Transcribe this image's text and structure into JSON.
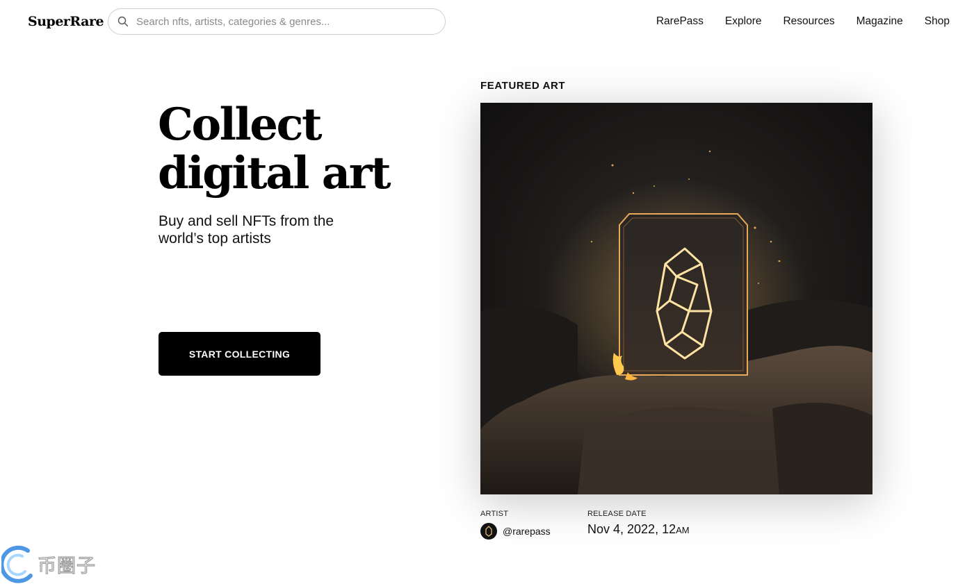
{
  "header": {
    "logo": "SuperRare",
    "search_placeholder": "Search nfts, artists, categories & genres...",
    "nav": [
      "RarePass",
      "Explore",
      "Resources",
      "Magazine",
      "Shop"
    ]
  },
  "hero": {
    "title_line1": "Collect",
    "title_line2": "digital art",
    "subtitle": "Buy and sell NFTs from the world’s top artists",
    "cta": "START COLLECTING"
  },
  "featured": {
    "label": "FEATURED ART",
    "artist_label": "ARTIST",
    "artist_handle": "@rarepass",
    "release_label": "RELEASE DATE",
    "release_date": "Nov 4, 2022, 12",
    "release_ampm": "AM"
  },
  "watermark": {
    "text": "币圈子"
  },
  "colors": {
    "background": "#ffffff",
    "text": "#000000",
    "button": "#000000",
    "accent_glow": "#f7c66b"
  }
}
